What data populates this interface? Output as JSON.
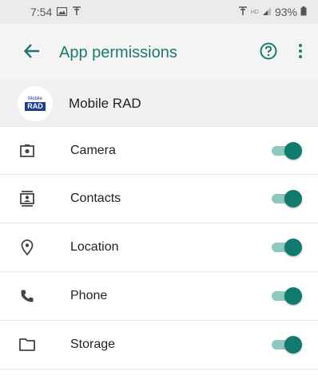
{
  "status_bar": {
    "time": "7:54",
    "battery": "93%",
    "network": "HD"
  },
  "app_bar": {
    "title": "App permissions"
  },
  "app": {
    "name": "Mobile RAD",
    "logo_text_top": "Mobile",
    "logo_text_bottom": "RAD"
  },
  "permissions": [
    {
      "label": "Camera",
      "icon": "camera-icon",
      "enabled": true
    },
    {
      "label": "Contacts",
      "icon": "contacts-icon",
      "enabled": true
    },
    {
      "label": "Location",
      "icon": "location-icon",
      "enabled": true
    },
    {
      "label": "Phone",
      "icon": "phone-icon",
      "enabled": true
    },
    {
      "label": "Storage",
      "icon": "folder-icon",
      "enabled": true
    }
  ],
  "colors": {
    "accent": "#1b7a6e",
    "toggle_track": "#8fc8bf",
    "toggle_thumb": "#117a6e"
  }
}
